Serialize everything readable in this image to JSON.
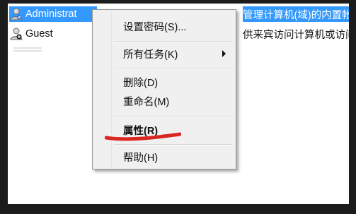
{
  "users": [
    {
      "name": "Administrat",
      "description": "管理计算机(域)的内置帐",
      "selected": true,
      "icon": "user-icon"
    },
    {
      "name": "Guest",
      "description": "供来宾访问计算机或访问",
      "selected": false,
      "icon": "user-icon"
    }
  ],
  "context_menu": {
    "items": [
      {
        "label": "设置密码(S)..."
      },
      {
        "label": "所有任务(K)",
        "submenu": true
      },
      {
        "label": "删除(D)"
      },
      {
        "label": "重命名(M)"
      },
      {
        "label": "属性(R)",
        "bold": true
      },
      {
        "label": "帮助(H)"
      }
    ]
  },
  "colors": {
    "selection": "#3399ff",
    "annotation": "#d8281f",
    "menu_bg": "#f0f0f0"
  }
}
